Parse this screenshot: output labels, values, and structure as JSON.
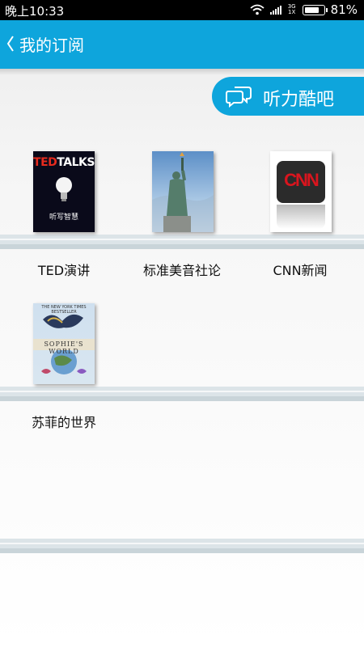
{
  "status_bar": {
    "time": "晚上10:33",
    "network_top": "3G",
    "network_bottom": "1X",
    "battery_percent": "81%",
    "battery_level": 0.81,
    "icons": [
      "wifi-icon",
      "signal-icon",
      "battery-icon"
    ]
  },
  "header": {
    "title": "我的订阅",
    "back_icon": "chevron-left-icon",
    "color": "#0ea5dc"
  },
  "listen_button": {
    "label": "听力酷吧",
    "icon": "chat-bubbles-icon"
  },
  "subscriptions": [
    {
      "title": "TED演讲",
      "cover": {
        "logo_red": "TED",
        "logo_white": "TALKS",
        "subtitle": "听写智慧"
      }
    },
    {
      "title": "标准美音社论",
      "cover": {}
    },
    {
      "title": "CNN新闻",
      "cover": {
        "logo": "CNN"
      }
    },
    {
      "title": "苏菲的世界",
      "cover": {
        "top_line": "THE NEW YORK TIMES BESTSELLER",
        "banner": "SOPHIE'S WORLD"
      }
    }
  ]
}
